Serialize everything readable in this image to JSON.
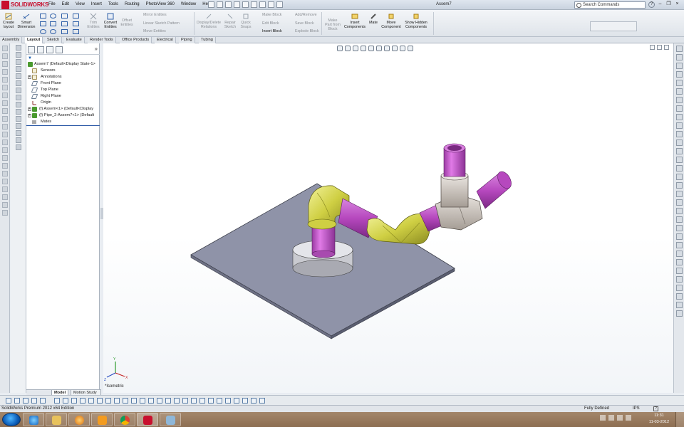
{
  "app": {
    "logo_text": "SOLIDWORKS",
    "doc_title": "Assem7",
    "menus": [
      "File",
      "Edit",
      "View",
      "Insert",
      "Tools",
      "Routing",
      "PhotoView 360",
      "Window",
      "Help"
    ],
    "search_placeholder": "Search Commands"
  },
  "command_manager": {
    "create_layout": "Create layout",
    "smart_dimension": "Smart Dimension",
    "trim_entities": "Trim Entities",
    "convert_entities": "Convert Entities",
    "offset_entities": "Offset Entities",
    "mirror_entities": "Mirror Entities",
    "linear_sketch_pattern": "Linear Sketch Pattern",
    "move_entities": "Move Entities",
    "display_delete_relations": "Display/Delete Relations",
    "repair_sketch": "Repair Sketch",
    "quick_snaps": "Quick Snaps",
    "make_block": "Make Block",
    "edit_block": "Edit Block",
    "insert_block": "Insert Block",
    "add_remove": "Add/Remove",
    "save_block": "Save Block",
    "explode_block": "Explode Block",
    "make_part_from_block": "Make Part from Block",
    "insert_components": "Insert Components",
    "mate": "Mate",
    "move_component": "Move Component",
    "show_hidden_components": "Show Hidden Components"
  },
  "tabs": [
    "Assembly",
    "Layout",
    "Sketch",
    "Evaluate",
    "Render Tools",
    "Office Products",
    "Electrical",
    "Piping",
    "Tubing"
  ],
  "active_tab": "Layout",
  "feature_tree": {
    "root": "Assem7 (Default<Display State-1>",
    "items": [
      "Sensors",
      "Annotations",
      "Front Plane",
      "Top Plane",
      "Right Plane",
      "Origin",
      "(f) Assem<1> (Default<Display",
      "(f) Pipe_2-Assem7<1> (Default",
      "Mates"
    ]
  },
  "bottom_tabs": [
    "Model",
    "Motion Study 1"
  ],
  "viewport": {
    "view_label": "*Isometric"
  },
  "status": {
    "app_edition": "SolidWorks Premium 2012 x64 Edition",
    "state": "Fully Defined",
    "units": "IPS",
    "help": "?"
  },
  "taskbar": {
    "time": "11:31",
    "date": "11-03-2012"
  },
  "colors": {
    "solidworks_red": "#c8102e",
    "pipe_magenta": "#c84fd0",
    "elbow_yellow": "#d8d84a",
    "tee_gray": "#cdc6bf",
    "plate_gray": "#8f93a8"
  }
}
